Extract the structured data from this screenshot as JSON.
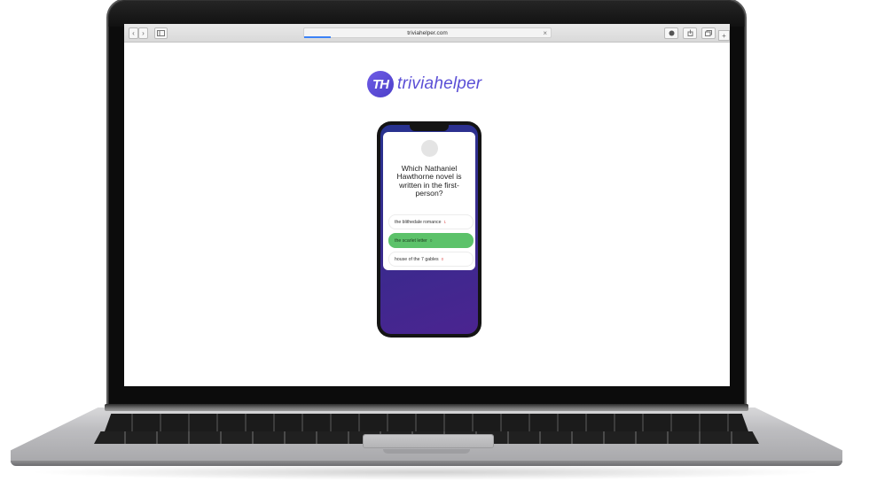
{
  "browser": {
    "url": "triviahelper.com",
    "back_icon": "‹",
    "forward_icon": "›",
    "close_icon": "×"
  },
  "brand": {
    "monogram": "TH",
    "name": "triviahelper",
    "color": "#5b4fd6"
  },
  "quiz": {
    "question": "Which Nathaniel Hawthorne novel is written in the first-person?",
    "answers": [
      {
        "label": "the blithedale romance",
        "mark": "1",
        "state": "wrong"
      },
      {
        "label": "the scarlet letter",
        "mark": "0",
        "state": "correct"
      },
      {
        "label": "house of the 7 gables",
        "mark": "0",
        "state": "wrong"
      }
    ]
  },
  "colors": {
    "correct": "#5cc26a",
    "phone_gradient_start": "#27328f",
    "phone_gradient_end": "#4b2490"
  }
}
